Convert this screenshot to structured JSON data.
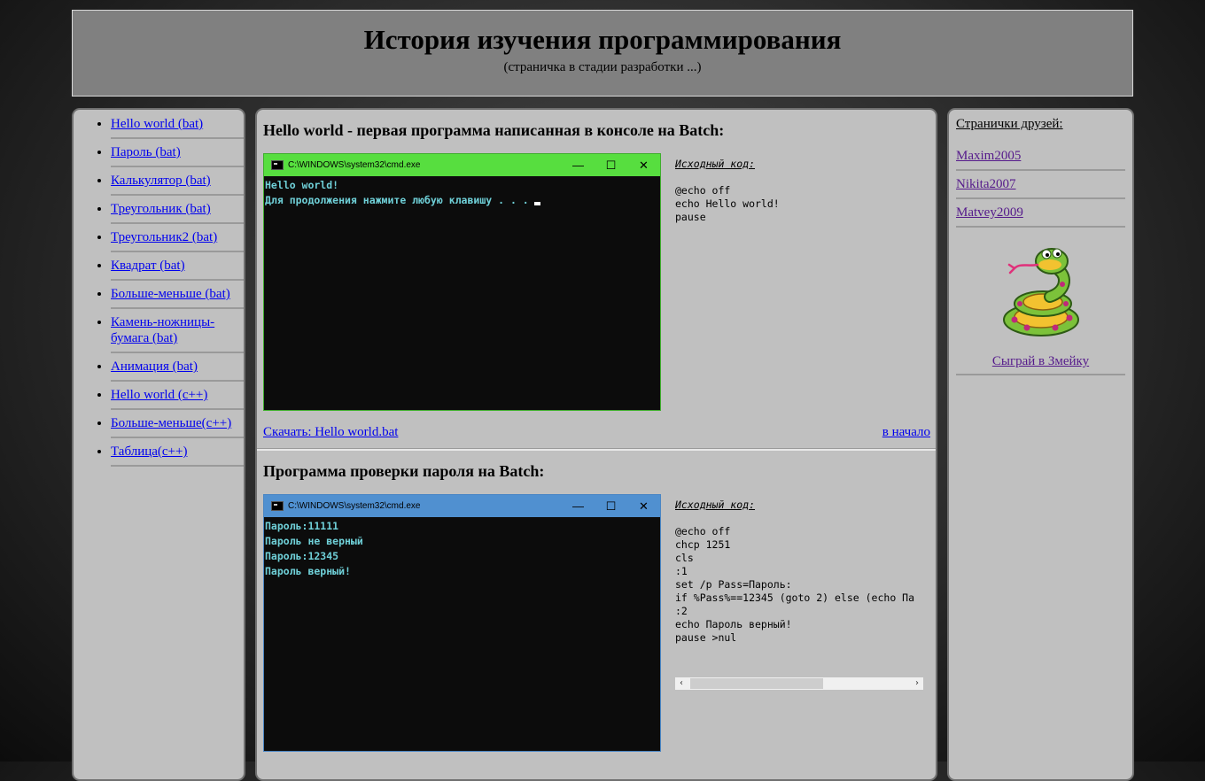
{
  "header": {
    "title": "История изучения программирования",
    "subtitle": "(страничка в стадии разработки ...)"
  },
  "nav": {
    "items": [
      {
        "label": "Hello world (bat)"
      },
      {
        "label": "Пароль (bat)"
      },
      {
        "label": "Калькулятор (bat)"
      },
      {
        "label": "Треугольник (bat)"
      },
      {
        "label": "Треугольник2 (bat)"
      },
      {
        "label": "Квадрат (bat)"
      },
      {
        "label": "Больше-меньше (bat)"
      },
      {
        "label": "Камень-ножницы-бумага (bat)"
      },
      {
        "label": "Анимация (bat)"
      },
      {
        "label": "Hello world (c++)"
      },
      {
        "label": "Больше-меньше(c++)"
      },
      {
        "label": "Таблица(c++)"
      }
    ]
  },
  "sections": [
    {
      "title": "Hello world - первая программа написанная в консоле на Batch:",
      "window": {
        "title": "C:\\WINDOWS\\system32\\cmd.exe",
        "titlebar_color": "#57de3f",
        "border_color": "#3fae2d",
        "output": "Hello world!\nДля продолжения нажмите любую клавишу . . ."
      },
      "code_label": "Исходный код:",
      "code": "@echo off\necho Hello world!\npause",
      "download": "Скачать: Hello world.bat",
      "to_top": "в начало"
    },
    {
      "title": "Программа проверки пароля на Batch:",
      "window": {
        "title": "C:\\WINDOWS\\system32\\cmd.exe",
        "titlebar_color": "#5090d0",
        "border_color": "#4a86c4",
        "output": "Пароль:11111\nПароль не верный\nПароль:12345\nПароль верный!"
      },
      "code_label": "Исходный код:",
      "code": "@echo off\nchcp 1251\ncls\n:1\nset /p Pass=Пароль:\nif %Pass%==12345 (goto 2) else (echo Па\n:2\necho Пароль верный!\npause >nul"
    }
  ],
  "window_buttons": {
    "minimize": "—",
    "maximize": "☐",
    "close": "✕"
  },
  "scroll_arrows": {
    "left": "‹",
    "right": "›"
  },
  "friends": {
    "title": "Странички друзей:",
    "links": [
      {
        "label": "Maxim2005"
      },
      {
        "label": "Nikita2007"
      },
      {
        "label": "Matvey2009"
      }
    ]
  },
  "snake_game": {
    "label": "Сыграй в Змейку"
  },
  "colors": {
    "panel_bg": "#c0c0c0",
    "header_bg": "#808080",
    "link": "#0000ee",
    "visited_link": "#551a8b",
    "console_text": "#6fd0d8"
  }
}
